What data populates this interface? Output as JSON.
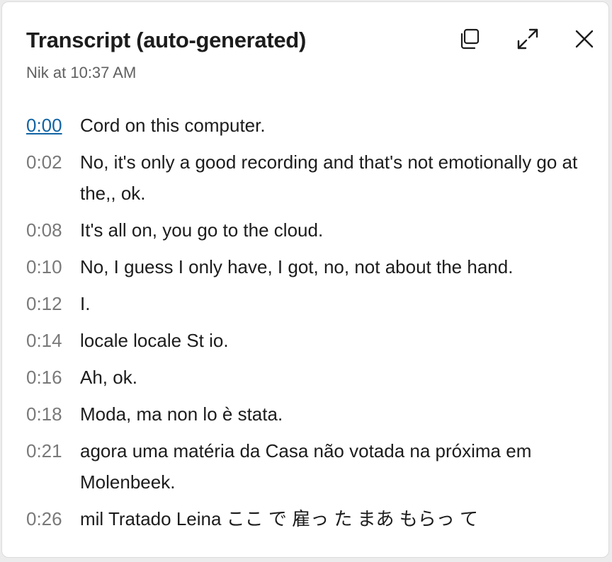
{
  "header": {
    "title": "Transcript (auto-generated)",
    "subtitle": "Nik at 10:37 AM"
  },
  "icons": {
    "copy": "copy-icon",
    "expand": "expand-icon",
    "close": "close-icon"
  },
  "colors": {
    "active_timestamp": "#1264a3",
    "timestamp": "#7a797a",
    "text": "#1d1c1d"
  },
  "transcript": [
    {
      "time": "0:00",
      "text": "Cord on this computer.",
      "active": true
    },
    {
      "time": "0:02",
      "text": "No, it's only a good recording and that's not emotionally go at the,, ok.",
      "active": false
    },
    {
      "time": "0:08",
      "text": "It's all on, you go to the cloud.",
      "active": false
    },
    {
      "time": "0:10",
      "text": "No, I guess I only have, I got, no, not about the hand.",
      "active": false
    },
    {
      "time": "0:12",
      "text": "I.",
      "active": false
    },
    {
      "time": "0:14",
      "text": "locale locale St io.",
      "active": false
    },
    {
      "time": "0:16",
      "text": "Ah, ok.",
      "active": false
    },
    {
      "time": "0:18",
      "text": "Moda, ma non lo è stata.",
      "active": false
    },
    {
      "time": "0:21",
      "text": "agora uma matéria da Casa não votada na próxima em Molenbeek.",
      "active": false
    },
    {
      "time": "0:26",
      "text": "mil Tratado Leina ここ で 雇っ た まあ もらっ て",
      "active": false
    }
  ]
}
